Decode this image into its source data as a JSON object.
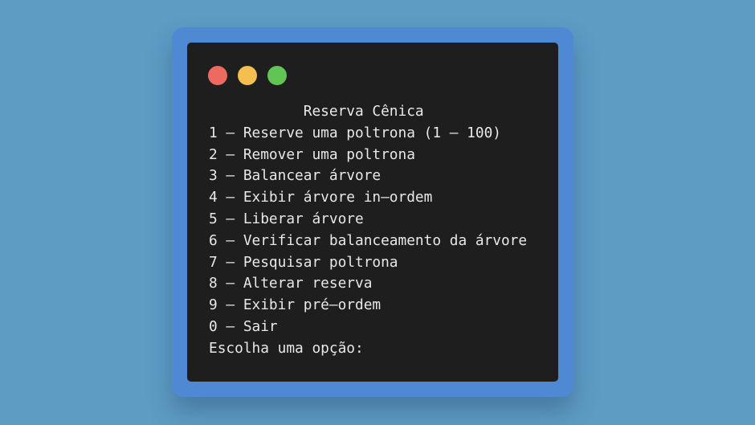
{
  "window": {
    "controls": [
      {
        "name": "close-button",
        "color": "#ec6a5f"
      },
      {
        "name": "minimize-button",
        "color": "#f4bf4f"
      },
      {
        "name": "maximize-button",
        "color": "#61c554"
      }
    ]
  },
  "terminal": {
    "lines": [
      "           Reserva Cênica",
      "1 – Reserve uma poltrona (1 – 100)",
      "2 – Remover uma poltrona",
      "3 – Balancear árvore",
      "4 – Exibir árvore in–ordem",
      "5 – Liberar árvore",
      "6 – Verificar balanceamento da árvore",
      "7 – Pesquisar poltrona",
      "8 – Alterar reserva",
      "9 – Exibir pré–ordem",
      "0 – Sair",
      "Escolha uma opção:"
    ]
  },
  "colors": {
    "background": "#5e9cc4",
    "frame": "#4f89d3",
    "terminal_bg": "#1e1e1e",
    "text": "#e8e8e8"
  }
}
